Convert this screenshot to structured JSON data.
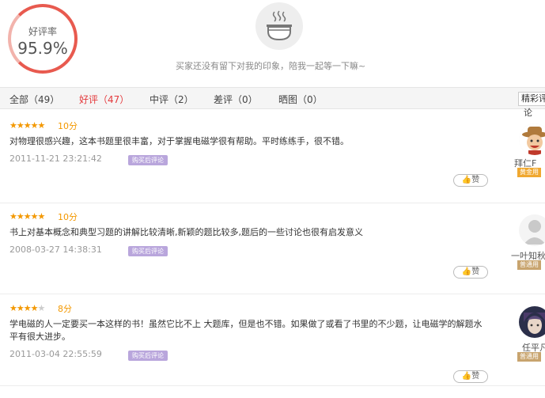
{
  "rating": {
    "label": "好评率",
    "value": "95.9%"
  },
  "empty_message": "买家还没有留下对我的印象，陪我一起等一下嘛~",
  "tabs": [
    {
      "label": "全部（49）"
    },
    {
      "label": "好评（47）"
    },
    {
      "label": "中评（2）"
    },
    {
      "label": "差评（0）"
    },
    {
      "label": "晒图（0）"
    }
  ],
  "sort": {
    "label": "精彩评",
    "overflow": "论"
  },
  "reviews": [
    {
      "stars": 5,
      "score": "10分",
      "text": "对物理很感兴趣，这本书题里很丰富，对于掌握电磁学很有帮助。平时练练手，很不错。",
      "date": "2011-11-21 23:21:42",
      "badge": "购买后评论",
      "like": "赞",
      "user": {
        "name": "拜仁F",
        "level": "黄金用",
        "avatar": "cowboy-avatar-icon"
      }
    },
    {
      "stars": 5,
      "score": "10分",
      "text": "书上对基本概念和典型习题的讲解比较清晰,新颖的题比较多,题后的一些讨论也很有启发意义",
      "date": "2008-03-27 14:38:31",
      "badge": "购买后评论",
      "like": "赞",
      "user": {
        "name": "一叶知秋",
        "level": "普通用",
        "avatar": "default-user-avatar-icon"
      }
    },
    {
      "stars": 4,
      "score": "8分",
      "text": "学电磁的人一定要买一本这样的书！虽然它比不上 大题库，但是也不错。如果做了或看了书里的不少题，让电磁学的解题水平有很大进步。",
      "date": "2011-03-04 22:55:59",
      "badge": "购买后评论",
      "like": "赞",
      "user": {
        "name": "任平凡",
        "level": "普通用",
        "avatar": "anime-avatar-icon"
      }
    }
  ],
  "colors": {
    "accent": "#e4393c",
    "star": "#f39800",
    "badge": "#b9a6dc",
    "gold_badge": "#f0a830",
    "normal_badge": "#c8a46e"
  }
}
